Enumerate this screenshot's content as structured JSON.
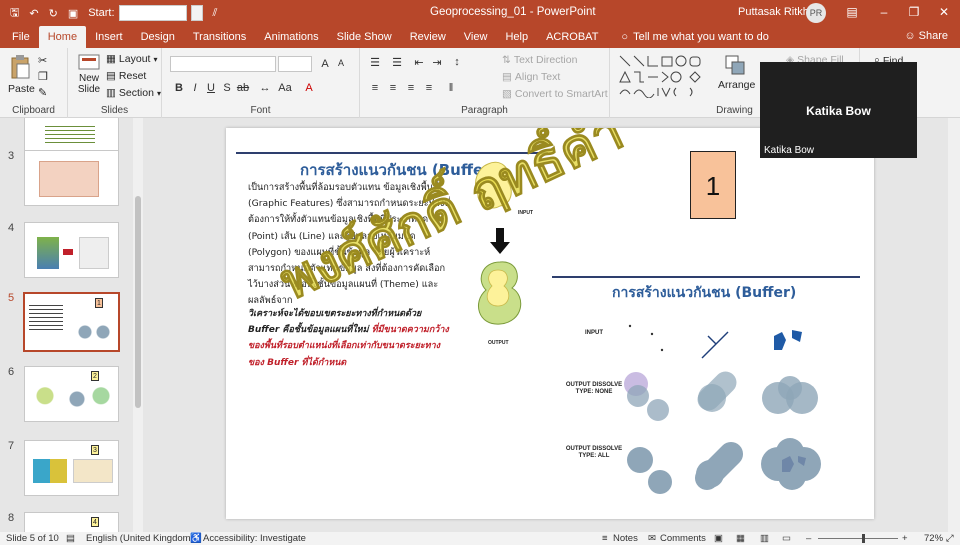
{
  "app": {
    "document_title": "Geoprocessing_01  -  PowerPoint",
    "user_name": "Puttasak Ritkham",
    "user_initials": "PR",
    "qat_start_label": "Start:"
  },
  "menu": {
    "tabs": [
      "File",
      "Home",
      "Insert",
      "Design",
      "Transitions",
      "Animations",
      "Slide Show",
      "Review",
      "View",
      "Help",
      "ACROBAT"
    ],
    "active_tab": "Home",
    "tell_me": "Tell me what you want to do",
    "share": "Share"
  },
  "ribbon": {
    "clipboard": {
      "label": "Clipboard",
      "paste": "Paste"
    },
    "slides": {
      "label": "Slides",
      "new_slide": "New Slide",
      "layout": "Layout",
      "reset": "Reset",
      "section": "Section"
    },
    "font": {
      "label": "Font"
    },
    "paragraph": {
      "label": "Paragraph",
      "text_direction": "Text Direction",
      "align_text": "Align Text",
      "convert_smartart": "Convert to SmartArt"
    },
    "drawing": {
      "label": "Drawing",
      "arrange": "Arrange",
      "shape_fill": "Shape Fill"
    },
    "editing": {
      "find": "Find"
    }
  },
  "thumbnails": [
    {
      "num": "3"
    },
    {
      "num": "4"
    },
    {
      "num": "5",
      "badge": "1"
    },
    {
      "num": "6",
      "badge": "2"
    },
    {
      "num": "7",
      "badge": "3"
    },
    {
      "num": "8",
      "badge": "4"
    }
  ],
  "slide": {
    "title_top": "การสร้างแนวกันชน (Buffer)",
    "title_bottom": "การสร้างแนวกันชน (Buffer)",
    "body": "เป็นการสร้างพื้นที่ล้อมรอบตัวแทน ข้อมูลเชิงพื้นที่ (Graphic Features) ซึ่งสามารถกำหนดระยะห่างที่ต้องการให้ทั้งตัวแทนข้อมูลเชิงพื้นที่ประเภทจุด (Point) เส้น (Line) และรูปหลายเหลี่ยมปิด (Polygon) ของแผนที่ชั้นข้อมูล โดยผู้วิเคราะห์สามารถกำหนดตัวแทนข้อมูล สิ่งที่ต้องการคัดเลือกไว้บางส่วนหรือทั้งชั้นข้อมูลแผนที่ (Theme) และผลลัพธ์จาก",
    "body2_black": "วิเคราะห์จะได้ขอบเขตระยะทางที่กำหนดด้วย Buffer คือชั้นข้อมูลแผนที่ใหม่",
    "body2_red": "ที่มีขนาดความกว้างของพื้นที่รอบตำแหน่งที่เลือกเท่ากับขนาดระยะทางของ Buffer ที่ได้กำหนด",
    "number_box": "1",
    "input_small": "INPUT",
    "output_small": "OUTPUT",
    "row_input": "INPUT",
    "row_none": "OUTPUT DISSOLVE TYPE: NONE",
    "row_all": "OUTPUT DISSOLVE TYPE: ALL",
    "watermark": "พงศ์ศักดิ์ ฤทธิ์คำ"
  },
  "video": {
    "name": "Katika Bow",
    "label": "Katika Bow"
  },
  "status": {
    "slide_info": "Slide 5 of 10",
    "language": "English (United Kingdom)",
    "accessibility": "Accessibility: Investigate",
    "notes": "Notes",
    "comments": "Comments",
    "zoom": "72%"
  },
  "colors": {
    "accent": "#b7472a",
    "title_blue": "#2e5d9a",
    "box_orange": "#f8c29a",
    "buffer_green": "#c9df8a",
    "buffer_yellow": "#fdf29a",
    "gray_blue": "#8fa6b8",
    "polygon_blue": "#1f5aa6"
  }
}
